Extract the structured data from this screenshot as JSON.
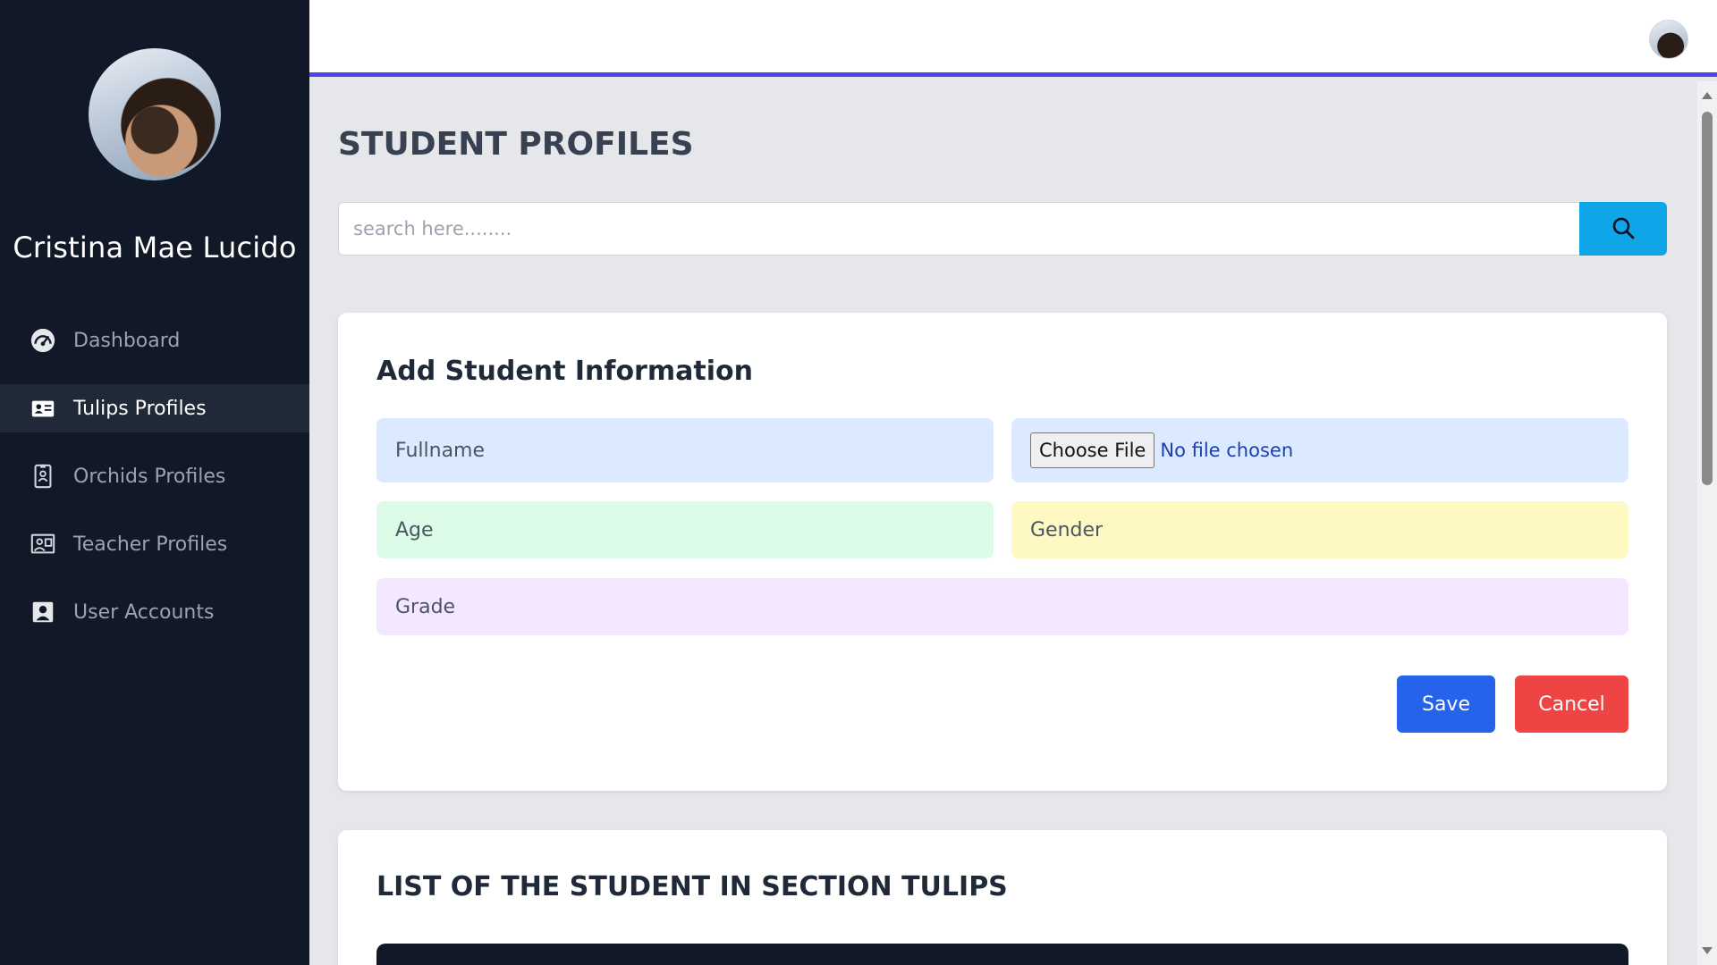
{
  "sidebar": {
    "user_name": "Cristina Mae Lucido",
    "items": [
      {
        "label": "Dashboard",
        "icon": "dashboard-gauge-icon",
        "active": false
      },
      {
        "label": "Tulips Profiles",
        "icon": "id-card-icon",
        "active": true
      },
      {
        "label": "Orchids Profiles",
        "icon": "id-badge-icon",
        "active": false
      },
      {
        "label": "Teacher Profiles",
        "icon": "teacher-board-icon",
        "active": false
      },
      {
        "label": "User Accounts",
        "icon": "user-account-icon",
        "active": false
      }
    ]
  },
  "header": {
    "avatar": "user-avatar"
  },
  "main": {
    "title": "STUDENT PROFILES",
    "search": {
      "placeholder": "search here........",
      "button_icon": "search-icon"
    },
    "form": {
      "title": "Add Student Information",
      "fullname_placeholder": "Fullname",
      "file_button": "Choose File",
      "file_status": "No file chosen",
      "age_placeholder": "Age",
      "gender_placeholder": "Gender",
      "grade_placeholder": "Grade",
      "save_label": "Save",
      "cancel_label": "Cancel"
    },
    "list": {
      "title": "LIST OF THE STUDENT IN SECTION TULIPS"
    }
  },
  "colors": {
    "sidebar_bg": "#111827",
    "accent_line": "#4f46e5",
    "search_button": "#0ea5e9",
    "save_button": "#2563eb",
    "cancel_button": "#ef4444"
  }
}
